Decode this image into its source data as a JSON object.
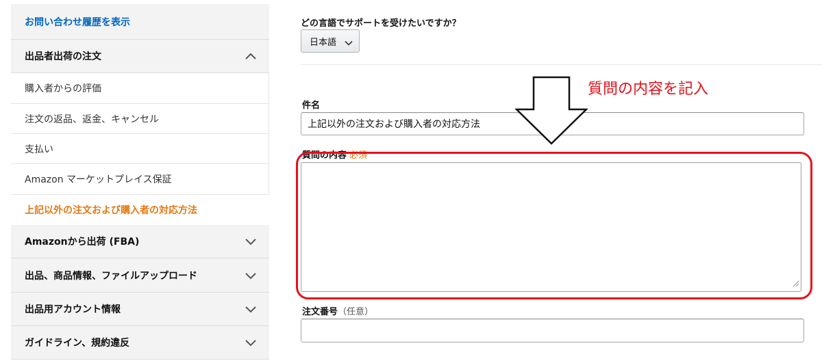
{
  "sidebar": {
    "history_link": "お問い合わせ履歴を表示",
    "sections": [
      {
        "label": "出品者出荷の注文",
        "expanded": true
      },
      {
        "label": "Amazonから出荷 (FBA)",
        "expanded": false
      },
      {
        "label": "出品、商品情報、ファイルアップロード",
        "expanded": false
      },
      {
        "label": "出品用アカウント情報",
        "expanded": false
      },
      {
        "label": "ガイドライン、規約違反",
        "expanded": false
      }
    ],
    "subitems": [
      "購入者からの評価",
      "注文の返品、返金、キャンセル",
      "支払い",
      "Amazon マーケットプレイス保証"
    ],
    "active_item": "上記以外の注文および購入者の対応方法"
  },
  "form": {
    "language_question": "どの言語でサポートを受けたいですか？",
    "language_value": "日本語",
    "subject_label": "件名",
    "subject_value": "上記以外の注文および購入者の対応方法",
    "details_label": "質問の内容",
    "required_tag": "必須",
    "details_value": "",
    "order_label": "注文番号",
    "optional_tag": "（任意）",
    "order_value": ""
  },
  "annotation": {
    "text": "質問の内容を記入",
    "color": "#e8101a"
  },
  "colors": {
    "link": "#0066c0",
    "active": "#e47911",
    "sidebar_bg": "#f3f3f3"
  }
}
